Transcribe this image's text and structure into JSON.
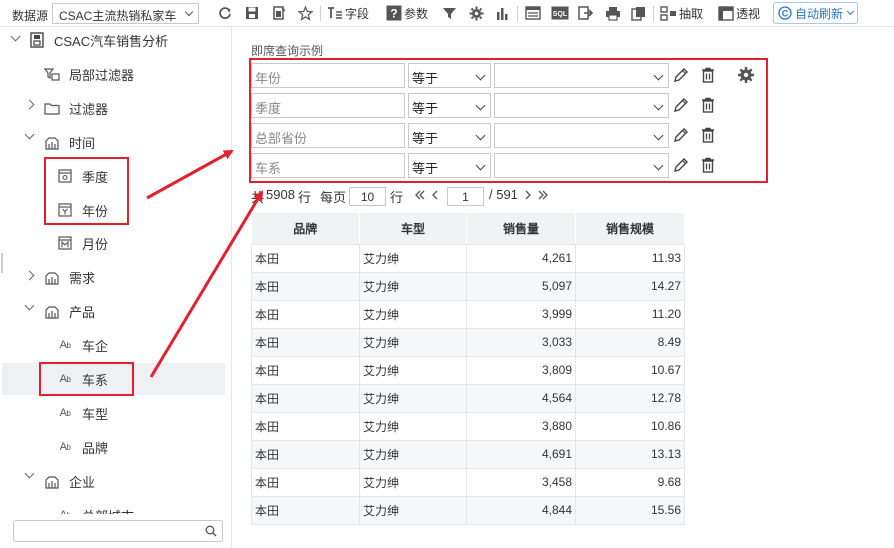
{
  "toolbar": {
    "datasource_label": "数据源",
    "datasource_value": "CSAC主流热销私家车",
    "field_label": "字段",
    "param_label": "参数",
    "sql_label": "SQL",
    "extract_label": "抽取",
    "pivot_label": "透视",
    "auto_refresh_label": "自动刷新"
  },
  "tree": {
    "root": "CSAC汽车销售分析",
    "items": [
      {
        "label": "局部过滤器"
      },
      {
        "label": "过滤器"
      },
      {
        "label": "时间"
      },
      {
        "label": "季度"
      },
      {
        "label": "年份"
      },
      {
        "label": "月份"
      },
      {
        "label": "需求"
      },
      {
        "label": "产品"
      },
      {
        "label": "车企"
      },
      {
        "label": "车系"
      },
      {
        "label": "车型"
      },
      {
        "label": "品牌"
      },
      {
        "label": "企业"
      },
      {
        "label": "总部城市"
      }
    ],
    "search_placeholder": ""
  },
  "query": {
    "title": "即席查询示例",
    "rows": [
      {
        "field": "年份",
        "operator": "等于",
        "value": ""
      },
      {
        "field": "季度",
        "operator": "等于",
        "value": ""
      },
      {
        "field": "总部省份",
        "operator": "等于",
        "value": ""
      },
      {
        "field": "车系",
        "operator": "等于",
        "value": ""
      }
    ]
  },
  "pager": {
    "total_prefix": "共",
    "total": "5908",
    "total_suffix": "行",
    "per_page_label": "每页",
    "per_page": "10",
    "per_page_suffix": "行",
    "current_page": "1",
    "total_pages": "/ 591"
  },
  "table": {
    "columns": [
      "品牌",
      "车型",
      "销售量",
      "销售规模"
    ],
    "rows": [
      [
        "本田",
        "艾力绅",
        "4,261",
        "11.93"
      ],
      [
        "本田",
        "艾力绅",
        "5,097",
        "14.27"
      ],
      [
        "本田",
        "艾力绅",
        "3,999",
        "11.20"
      ],
      [
        "本田",
        "艾力绅",
        "3,033",
        "8.49"
      ],
      [
        "本田",
        "艾力绅",
        "3,809",
        "10.67"
      ],
      [
        "本田",
        "艾力绅",
        "4,564",
        "12.78"
      ],
      [
        "本田",
        "艾力绅",
        "3,880",
        "10.86"
      ],
      [
        "本田",
        "艾力绅",
        "4,691",
        "13.13"
      ],
      [
        "本田",
        "艾力绅",
        "3,458",
        "9.68"
      ],
      [
        "本田",
        "艾力绅",
        "4,844",
        "15.56"
      ]
    ]
  },
  "colors": {
    "annotation_red": "#e2212e",
    "accent_blue": "#2a73c5"
  }
}
